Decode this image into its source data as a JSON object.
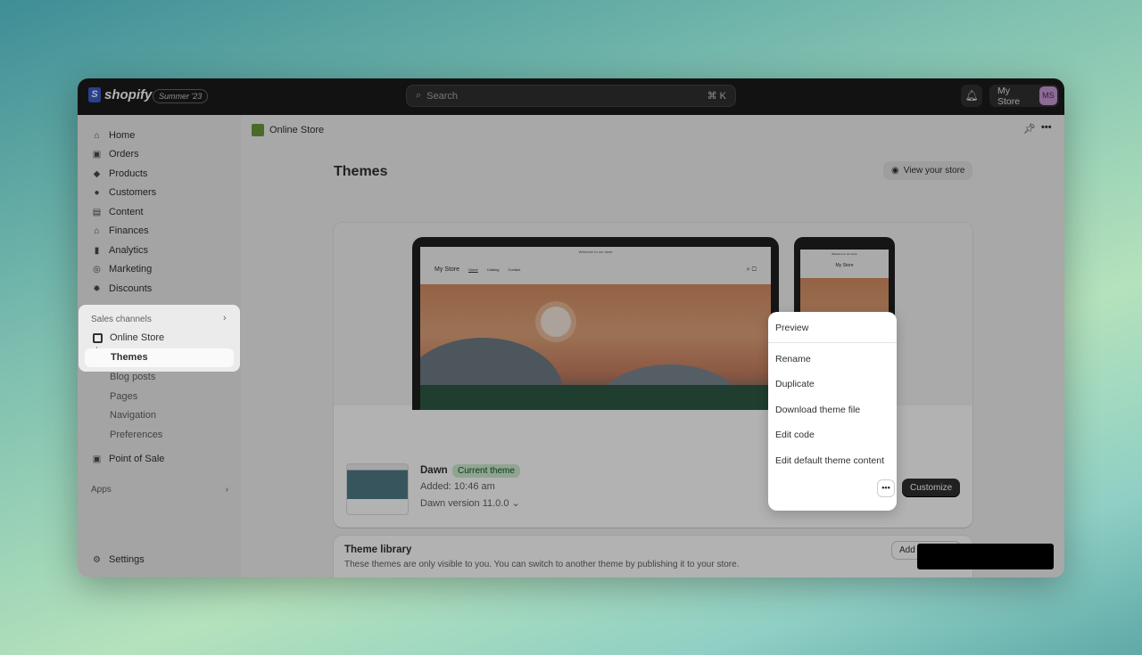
{
  "topbar": {
    "brand": "shopify",
    "edition": "Summer '23",
    "search_placeholder": "Search",
    "search_shortcut": "⌘ K",
    "store_name": "My Store",
    "avatar_initials": "MS"
  },
  "sidebar": {
    "items": [
      {
        "label": "Home",
        "icon": "home-icon"
      },
      {
        "label": "Orders",
        "icon": "inbox-icon"
      },
      {
        "label": "Products",
        "icon": "tag-icon"
      },
      {
        "label": "Customers",
        "icon": "person-icon"
      },
      {
        "label": "Content",
        "icon": "image-icon"
      },
      {
        "label": "Finances",
        "icon": "bank-icon"
      },
      {
        "label": "Analytics",
        "icon": "bar-chart-icon"
      },
      {
        "label": "Marketing",
        "icon": "target-icon"
      },
      {
        "label": "Discounts",
        "icon": "discount-icon"
      }
    ],
    "sales_channels": "Sales channels",
    "online_store": "Online Store",
    "themes": "Themes",
    "sub": [
      "Blog posts",
      "Pages",
      "Navigation",
      "Preferences"
    ],
    "pos": "Point of Sale",
    "apps": "Apps",
    "settings": "Settings"
  },
  "main": {
    "breadcrumb": "Online Store",
    "title": "Themes",
    "view_store": "View your store",
    "preview": {
      "announcement": "Welcome to our store",
      "store": "My Store",
      "links": [
        "Home",
        "Catalog",
        "Contact"
      ]
    },
    "theme": {
      "name": "Dawn",
      "badge": "Current theme",
      "added": "Added: 10:46 am",
      "version": "Dawn version 11.0.0",
      "customize": "Customize",
      "more": "•••"
    },
    "library": {
      "title": "Theme library",
      "desc": "These themes are only visible to you. You can switch to another theme by publishing it to your store.",
      "add": "Add theme"
    }
  },
  "menu": {
    "items": [
      "Preview",
      "Rename",
      "Duplicate",
      "Download theme file",
      "Edit code",
      "Edit default theme content"
    ]
  }
}
